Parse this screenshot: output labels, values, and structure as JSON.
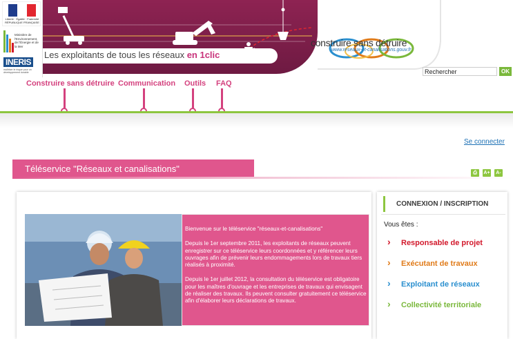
{
  "logos": {
    "rf_text": "Liberté · Égalité · Fraternité RÉPUBLIQUE FRANÇAISE",
    "ministere_text": "Ministère de l'Environnement, de l'Énergie et de la Mer",
    "ineris_name": "INERIS",
    "ineris_tagline": "maîtriser le risque pour un développement durable"
  },
  "banner": {
    "tagline_prefix": "Les exploitants de tous les réseaux ",
    "tagline_highlight": "en 1clic"
  },
  "brand": {
    "title": "construire sans détruire",
    "url": "www.reseaux-et-canalisations.gouv.fr"
  },
  "search": {
    "value": "Rechercher",
    "button_label": "OK"
  },
  "nav": {
    "items": [
      {
        "label": "Construire sans détruire"
      },
      {
        "label": "Communication"
      },
      {
        "label": "Outils"
      },
      {
        "label": "FAQ"
      }
    ]
  },
  "header": {
    "login_link": "Se connecter"
  },
  "page": {
    "title": "Téléservice \"Réseaux et canalisations\""
  },
  "tools": {
    "print_icon": "print-icon",
    "font_increase_icon": "font-increase-icon",
    "font_decrease_icon": "font-decrease-icon"
  },
  "welcome": {
    "intro": "Bienvenue sur le téléservice \"réseaux-et-canalisations\"",
    "para1": "Depuis le 1er septembre 2011, les exploitants de réseaux peuvent enregistrer sur ce téléservice leurs coordonnées et y référencer leurs ouvrages afin de prévenir leurs endommagements lors de travaux tiers réalisés à proximité.",
    "para2": "Depuis le 1er juillet 2012, la consultation du téléservice est obligatoire pour les maîtres d'ouvrage et les entreprises de travaux qui envisagent de réaliser des travaux. Ils peuvent consulter gratuitement ce téléservice afin d'élaborer leurs déclarations de travaux."
  },
  "sidebar": {
    "title": "CONNEXION / INSCRIPTION",
    "prompt": "Vous êtes :",
    "roles": [
      {
        "label": "Responsable de projet",
        "color": "#d2182b"
      },
      {
        "label": "Exécutant de travaux",
        "color": "#e07b1a"
      },
      {
        "label": "Exploitant de réseaux",
        "color": "#2a8fcf"
      },
      {
        "label": "Collectivité territoriale",
        "color": "#7ab83b"
      }
    ]
  },
  "colors": {
    "accent_pink": "#e0568d",
    "nav_pink": "#d4417e",
    "nav_green": "#8dc63f",
    "banner_purple": "#7a1d4a",
    "link_blue": "#1a6fb4"
  }
}
